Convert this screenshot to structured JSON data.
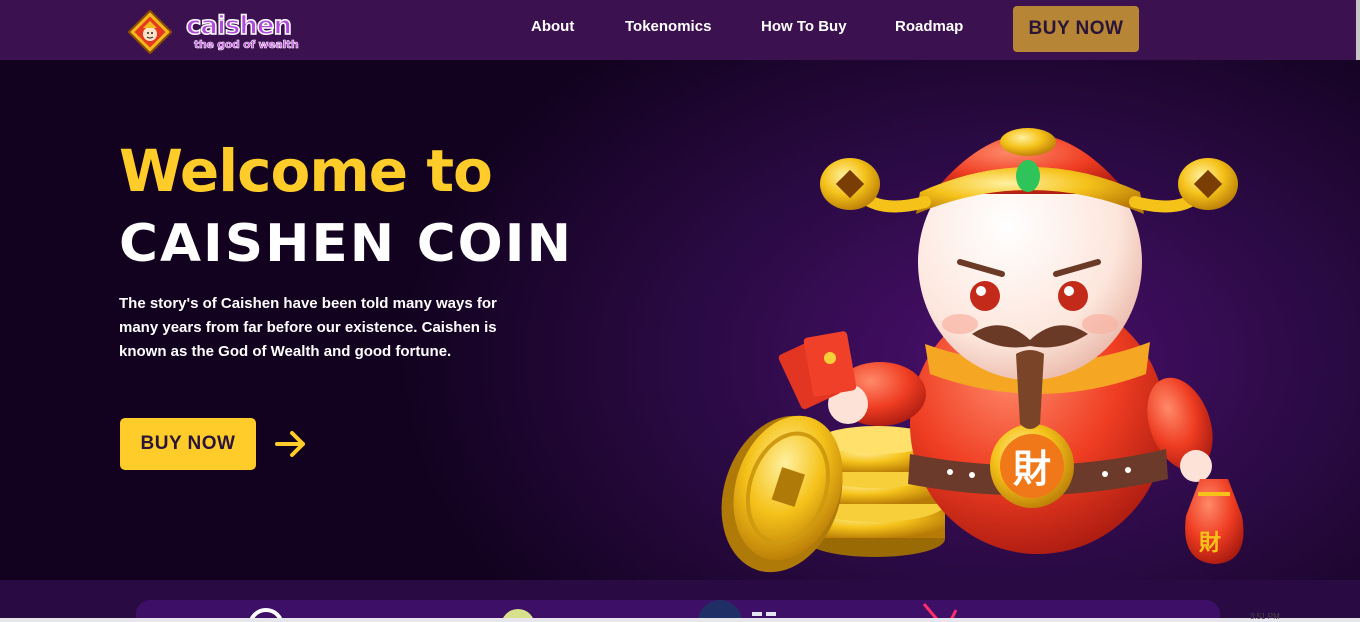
{
  "header": {
    "logo": {
      "wordmark": "caishen",
      "tagline": "the god of wealth"
    },
    "nav": [
      {
        "label": "About"
      },
      {
        "label": "Tokenomics"
      },
      {
        "label": "How To Buy"
      },
      {
        "label": "Roadmap"
      }
    ],
    "buy_label": "BUY NOW"
  },
  "hero": {
    "welcome": "Welcome to",
    "brand": "CAISHEN COIN",
    "description": "The story's of Caishen have been told many ways for many years from far before our existence. Caishen is known as the God of Wealth and good fortune.",
    "buy_label": "BUY NOW",
    "arrow_icon": "arrow-right-icon",
    "illustration": "caishen-god-of-wealth-with-gold-coins",
    "coin_glyph": "財"
  },
  "taskbar": {
    "clock": "3:51 PM"
  },
  "colors": {
    "nav_bg": "#3c1150",
    "accent_yellow": "#ffcc2a",
    "nav_button": "#b68535",
    "hero_bg": "#12021f",
    "hero_glow": "#4a0f6d"
  }
}
